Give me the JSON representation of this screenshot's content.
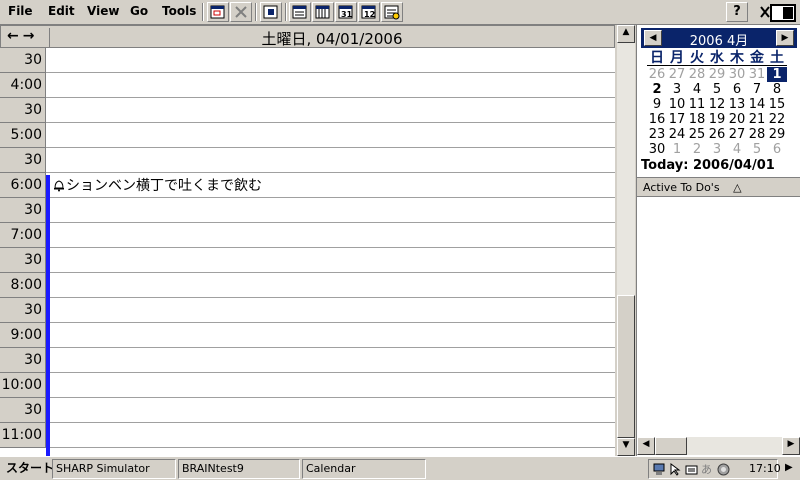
{
  "menubar": {
    "file": "File",
    "edit": "Edit",
    "view": "View",
    "go": "Go",
    "tools": "Tools",
    "help_label": "?"
  },
  "dayview": {
    "title": "土曜日, 04/01/2006",
    "hours": [
      "30",
      "4:00",
      "30",
      "5:00",
      "30",
      "6:00",
      "30",
      "7:00",
      "30",
      "8:00",
      "30",
      "9:00",
      "30",
      "10:00",
      "30",
      "11:00"
    ],
    "event": "ションベン横丁で吐くまで飲む",
    "event_icon": "alarm-bell-icon"
  },
  "calendar": {
    "month_title": "2006 4月",
    "weekdays": [
      "日",
      "月",
      "火",
      "水",
      "木",
      "金",
      "土"
    ],
    "weeks": [
      [
        {
          "d": "26",
          "o": true
        },
        {
          "d": "27",
          "o": true
        },
        {
          "d": "28",
          "o": true
        },
        {
          "d": "29",
          "o": true
        },
        {
          "d": "30",
          "o": true
        },
        {
          "d": "31",
          "o": true
        },
        {
          "d": "1",
          "t": true
        }
      ],
      [
        {
          "d": "2",
          "b": true
        },
        {
          "d": "3"
        },
        {
          "d": "4"
        },
        {
          "d": "5"
        },
        {
          "d": "6"
        },
        {
          "d": "7"
        },
        {
          "d": "8"
        }
      ],
      [
        {
          "d": "9"
        },
        {
          "d": "10"
        },
        {
          "d": "11"
        },
        {
          "d": "12"
        },
        {
          "d": "13"
        },
        {
          "d": "14"
        },
        {
          "d": "15"
        }
      ],
      [
        {
          "d": "16"
        },
        {
          "d": "17"
        },
        {
          "d": "18"
        },
        {
          "d": "19"
        },
        {
          "d": "20"
        },
        {
          "d": "21"
        },
        {
          "d": "22"
        }
      ],
      [
        {
          "d": "23"
        },
        {
          "d": "24"
        },
        {
          "d": "25"
        },
        {
          "d": "26"
        },
        {
          "d": "27"
        },
        {
          "d": "28"
        },
        {
          "d": "29"
        }
      ],
      [
        {
          "d": "30"
        },
        {
          "d": "1",
          "o": true
        },
        {
          "d": "2",
          "o": true
        },
        {
          "d": "3",
          "o": true
        },
        {
          "d": "4",
          "o": true
        },
        {
          "d": "5",
          "o": true
        },
        {
          "d": "6",
          "o": true
        }
      ]
    ],
    "today_label": "Today: 2006/04/01"
  },
  "todo": {
    "header": "Active To Do's",
    "sort_glyph": "△"
  },
  "taskbar": {
    "start": "スタート",
    "tasks": [
      "SHARP Simulator",
      "BRAINtest9",
      "Calendar"
    ],
    "clock": "17:10"
  },
  "colors": {
    "accent": "#0a246a",
    "busy_bar": "#1a1aff",
    "chrome": "#d4d0c8"
  }
}
